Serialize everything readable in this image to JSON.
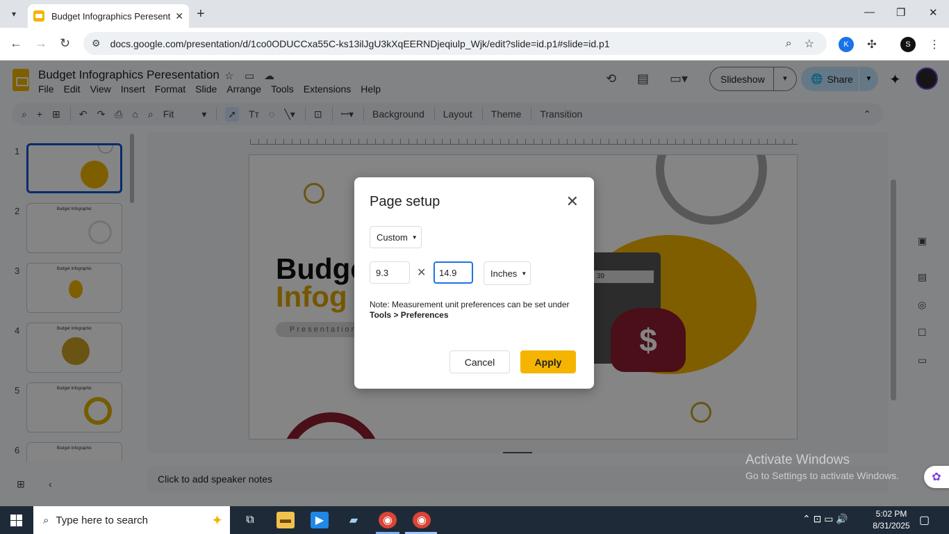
{
  "browser": {
    "tab_title": "Budget Infographics Peresentat",
    "url": "docs.google.com/presentation/d/1co0ODUCCxa55C-ks13ilJgU3kXqEERNDjeqiulp_Wjk/edit?slide=id.p1#slide=id.p1"
  },
  "app": {
    "doc_title": "Budget Infographics Peresentation",
    "menus": [
      "File",
      "Edit",
      "View",
      "Insert",
      "Format",
      "Slide",
      "Arrange",
      "Tools",
      "Extensions",
      "Help"
    ],
    "slideshow_label": "Slideshow",
    "share_label": "Share"
  },
  "toolbar": {
    "zoom": "Fit",
    "background": "Background",
    "layout": "Layout",
    "theme": "Theme",
    "transition": "Transition"
  },
  "filmstrip": {
    "slides": [
      {
        "num": "1",
        "title": ""
      },
      {
        "num": "2",
        "title": "Budget Infographic"
      },
      {
        "num": "3",
        "title": "Budget Infographic"
      },
      {
        "num": "4",
        "title": "Budget Infographic"
      },
      {
        "num": "5",
        "title": "Budget Infographic"
      },
      {
        "num": "6",
        "title": "Budget Infographic"
      }
    ]
  },
  "slide": {
    "title_line1": "Budge",
    "title_line2": "Infog",
    "pill": "Presentation",
    "calc_screen": "39",
    "bag_symbol": "$"
  },
  "notes": {
    "placeholder": "Click to add speaker notes"
  },
  "dialog": {
    "title": "Page setup",
    "preset": "Custom",
    "width": "9.3",
    "height": "14.9",
    "unit": "Inches",
    "note": "Note: Measurement unit preferences can be set under",
    "note_bold": "Tools > Preferences",
    "cancel": "Cancel",
    "apply": "Apply"
  },
  "watermark": {
    "line1": "Activate Windows",
    "line2": "Go to Settings to activate Windows."
  },
  "taskbar": {
    "search_placeholder": "Type here to search",
    "time": "5:02 PM",
    "date": "8/31/2025"
  },
  "colors": {
    "accent_yellow": "#f4b400",
    "focus_blue": "#1a73e8",
    "share_bg": "#c2e7ff",
    "maroon": "#8f1d2f"
  }
}
